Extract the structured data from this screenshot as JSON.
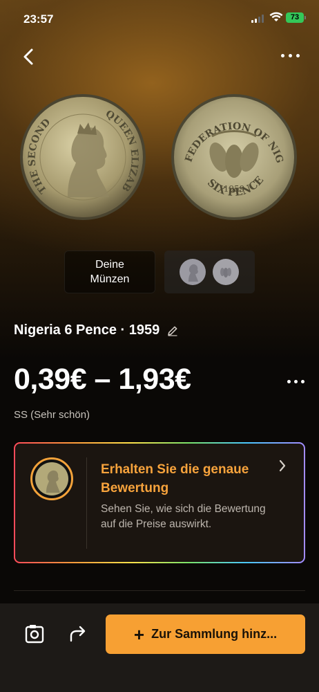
{
  "status": {
    "time": "23:57",
    "battery": "73"
  },
  "coin_images": {
    "front_legend": "THE SECOND · QUEEN ELIZABETH",
    "back_legend": "FEDERATION OF NIGERIA",
    "back_year": "1959",
    "back_denomination": "SIX PENCE"
  },
  "gallery": {
    "your_coins_label_line1": "Deine",
    "your_coins_label_line2": "Münzen"
  },
  "coin": {
    "title": "Nigeria 6 Pence · 1959"
  },
  "price": {
    "range": "0,39€ – 1,93€",
    "grade": "SS (Sehr schön)"
  },
  "grading_card": {
    "title": "Erhalten Sie die genaue Bewertung",
    "text": "Sehen Sie, wie sich die Bewertung auf die Preise auswirkt."
  },
  "bottom_bar": {
    "add_label": "Zur Sammlung hinz..."
  },
  "colors": {
    "accent": "#f7a033",
    "card_title": "#f7a33c",
    "background": "#0a0806"
  },
  "icons": [
    "back-icon",
    "more-icon",
    "edit-icon",
    "chevron-right-icon",
    "scan-icon",
    "share-icon",
    "plus-icon"
  ]
}
